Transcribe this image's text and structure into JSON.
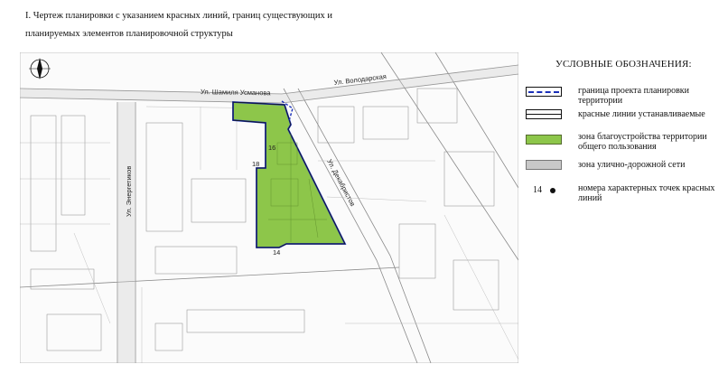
{
  "title": {
    "line1": "I. Чертеж планировки с указанием красных линий,  границ существующих и",
    "line2": "планируемых элементов планировочной структуры"
  },
  "map": {
    "streets": {
      "usmanova": "Ул. Шамиля Усманова",
      "volodarskaya": "Ул. Володарская",
      "energetikov": "Ул. Энергетиков",
      "dekabristov": "Ул. Декабристов"
    },
    "point_labels": [
      "18",
      "16",
      "14"
    ],
    "colors": {
      "zone_fill": "#8dc64a",
      "boundary": "#1a2fb8",
      "road_zone": "#c8c8c8",
      "basemap_line": "#7a7a7a"
    }
  },
  "legend": {
    "title": "УСЛОВНЫЕ ОБОЗНАЧЕНИЯ:",
    "items": [
      {
        "symbol": "blue-dashed-line",
        "text": "граница проекта планировки территории"
      },
      {
        "symbol": "double-black-line",
        "text": "красные линии устанавливаемые"
      },
      {
        "symbol": "green-fill",
        "text": "зона  благоустройства территории общего пользования"
      },
      {
        "symbol": "grey-fill",
        "text": "зона улично-дорожной сети"
      },
      {
        "symbol": "black-dot",
        "number": "14",
        "text": "номера характерных точек красных линий"
      }
    ]
  }
}
